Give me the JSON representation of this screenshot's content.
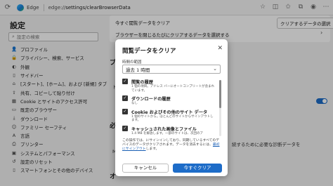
{
  "browser": {
    "app_name": "Edge",
    "url_scheme": "edge://",
    "url_path": "settings/clearBrowserData"
  },
  "sidebar": {
    "title": "設定",
    "search_placeholder": "設定の検索",
    "items": [
      {
        "label": "プロファイル",
        "icon": "person-icon"
      },
      {
        "label": "プライバシー、検索、サービス",
        "icon": "lock-icon"
      },
      {
        "label": "外観",
        "icon": "appearance-icon"
      },
      {
        "label": "サイドバー",
        "icon": "sidebar-icon"
      },
      {
        "label": "[スタート]、[ホーム]、および [新規] タブ",
        "icon": "home-icon"
      },
      {
        "label": "共有、コピーして貼り付け",
        "icon": "share-icon"
      },
      {
        "label": "Cookie とサイトのアクセス許可",
        "icon": "cookie-icon"
      },
      {
        "label": "既定のブラウザー",
        "icon": "browser-icon"
      },
      {
        "label": "ダウンロード",
        "icon": "download-icon"
      },
      {
        "label": "ファミリー セーフティ",
        "icon": "family-icon"
      },
      {
        "label": "言語",
        "icon": "language-icon"
      },
      {
        "label": "プリンター",
        "icon": "printer-icon"
      },
      {
        "label": "システムとパフォーマンス",
        "icon": "system-icon"
      },
      {
        "label": "設定のリセット",
        "icon": "reset-icon"
      },
      {
        "label": "スマートフォンとその他のデバイス",
        "icon": "phone-icon"
      }
    ]
  },
  "main": {
    "row1_label": "今すぐ閲覧データをクリア",
    "row1_button": "クリアするデータの選択",
    "row2_label": "ブラウザーを閉じるたびにクリアするデータを選択する",
    "bg_head1": "プ",
    "bg_t1": "ト",
    "bg_head2": "必",
    "bg_right1": "続するために必要な診断データを",
    "bg_t2": "M",
    "bg_head3": "オ"
  },
  "dialog": {
    "title": "閲覧データをクリア",
    "range_label": "時間の範囲",
    "range_value": "過去 1 時間",
    "items": [
      {
        "title": "閲覧の履歴",
        "desc1": "1 個の項目。アドレス バーにオートコンプリートが含まれ",
        "desc2": "ています。"
      },
      {
        "title": "ダウンロードの履歴",
        "desc1": "なし",
        "desc2": ""
      },
      {
        "title": "Cookie およびその他のサイト データ",
        "desc1": "1 個のサイトから。ほとんどのサイトからサインアウトし",
        "desc2": "ます。"
      },
      {
        "title": "キャッシュされた画像とファイル",
        "desc1": "1.4 MB を解放します。一部のサイトは、次回のア",
        "desc2": ""
      }
    ],
    "note_part1": "この操作では、",
    "note_part2": "にサインインしており、同期しているすべてのデバイスのデータがクリアされます。",
    "note_part3": "データを消去するには、",
    "note_link": "最初にサインアウト",
    "note_part4": "します。",
    "cancel_label": "キャンセル",
    "clear_label": "今すぐクリア"
  }
}
